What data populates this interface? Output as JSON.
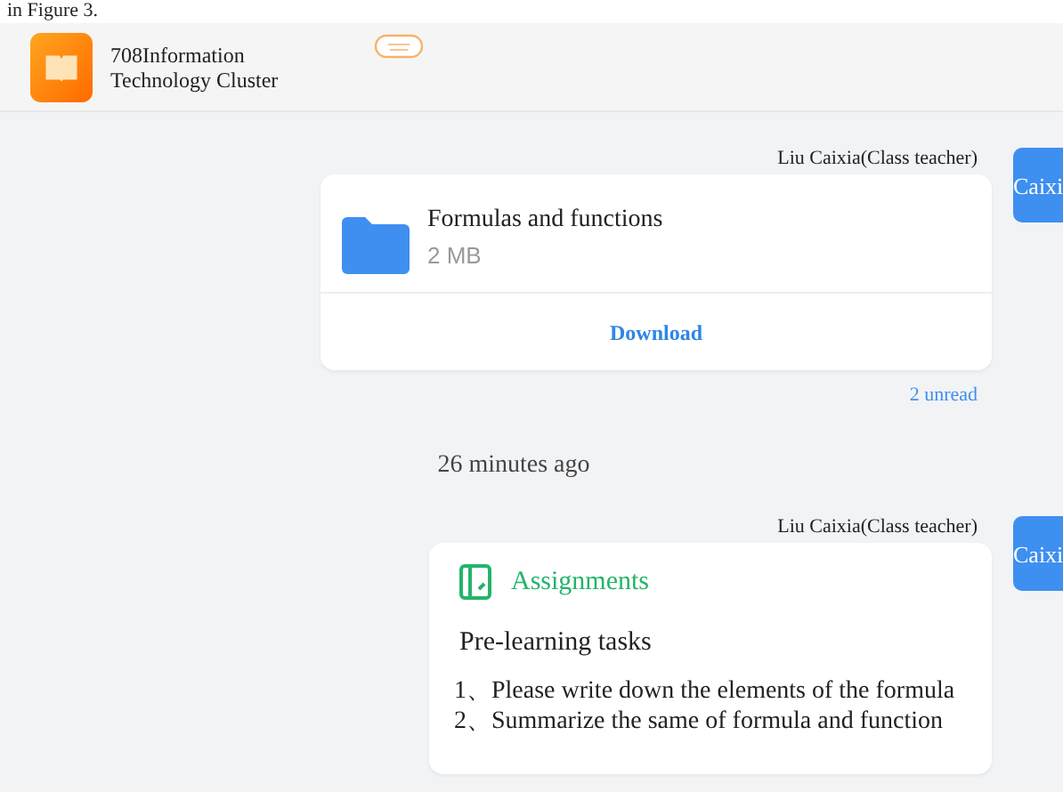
{
  "caption": "in Figure 3.",
  "header": {
    "title_line_1": "708Information",
    "title_line_2": "Technology Cluster"
  },
  "messages": [
    {
      "kind": "file",
      "sender": "Liu Caixia(Class teacher)",
      "avatar": "Caixi",
      "file_name": "Formulas and functions",
      "file_size": "2 MB",
      "action": "Download",
      "receipt": "2 unread"
    },
    {
      "kind": "time",
      "text": "26 minutes ago"
    },
    {
      "kind": "assignment",
      "sender": "Liu Caixia(Class teacher)",
      "avatar": "Caixi",
      "heading": "Assignments",
      "title": "Pre-learning tasks",
      "items": [
        "1、Please write down the elements of the formula",
        "2、Summarize the same of formula and function"
      ]
    }
  ]
}
